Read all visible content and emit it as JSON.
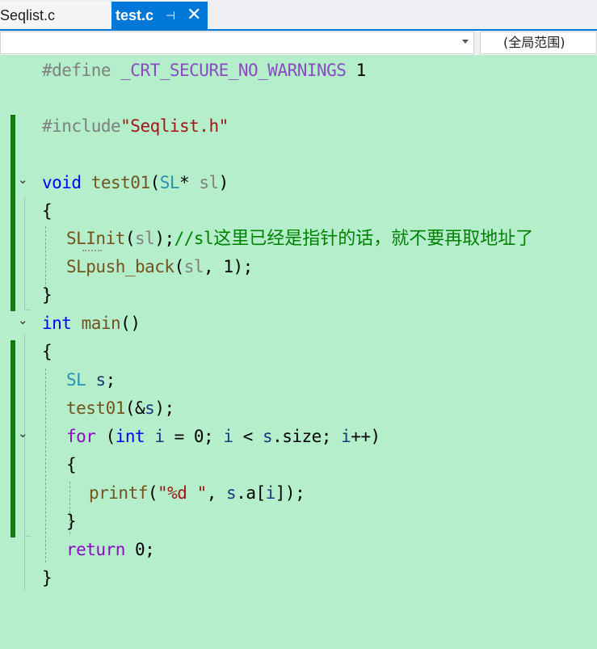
{
  "tabs": [
    {
      "label": "Seqlist.c",
      "active": false
    },
    {
      "label": "test.c",
      "active": true
    }
  ],
  "tab_icons": {
    "pin": "⊣",
    "close": "✕"
  },
  "navbar": {
    "scope": "(全局范围)"
  },
  "code": {
    "l1": {
      "pre": "#define ",
      "macro": "_CRT_SECURE_NO_WARNINGS",
      "rest": " 1"
    },
    "l3": {
      "pre": "#include",
      "str": "\"Seqlist.h\""
    },
    "l5": {
      "kw": "void",
      "sp": " ",
      "fn": "test01",
      "p1": "(",
      "type": "SL",
      "star": "* ",
      "param": "sl",
      "p2": ")"
    },
    "l6": {
      "t": "{"
    },
    "l7": {
      "fn": "SLInit",
      "p1": "(",
      "param": "sl",
      "p2": ");",
      "cmt": "//sl",
      "cjk": "这里已经是指针的话，就不要再取地址了"
    },
    "l8": {
      "fn": "SLpush_back",
      "p1": "(",
      "param": "sl",
      "p2": ", 1);"
    },
    "l9": {
      "t": "}"
    },
    "l10": {
      "kw": "int",
      "sp": " ",
      "fn": "main",
      "p": "()"
    },
    "l11": {
      "t": "{"
    },
    "l12": {
      "type": "SL",
      "sp": " ",
      "var": "s",
      "p": ";"
    },
    "l13": {
      "fn": "test01",
      "p1": "(&",
      "var": "s",
      "p2": ");"
    },
    "l14": {
      "kw": "for",
      "p1": " (",
      "kw2": "int",
      "sp": " ",
      "v1": "i",
      "p2": " = 0; ",
      "v2": "i",
      "p3": " < ",
      "v3": "s",
      "p4": ".size; ",
      "v4": "i",
      "p5": "++)"
    },
    "l15": {
      "t": "{"
    },
    "l16": {
      "fn": "printf",
      "p1": "(",
      "str": "\"%d \"",
      "p2": ", ",
      "v1": "s",
      "p3": ".a[",
      "v2": "i",
      "p4": "]);"
    },
    "l17": {
      "t": "}"
    },
    "l18": {
      "kw": "return",
      "p": " 0;"
    },
    "l19": {
      "t": "}"
    }
  },
  "fold_glyph": "⌄"
}
